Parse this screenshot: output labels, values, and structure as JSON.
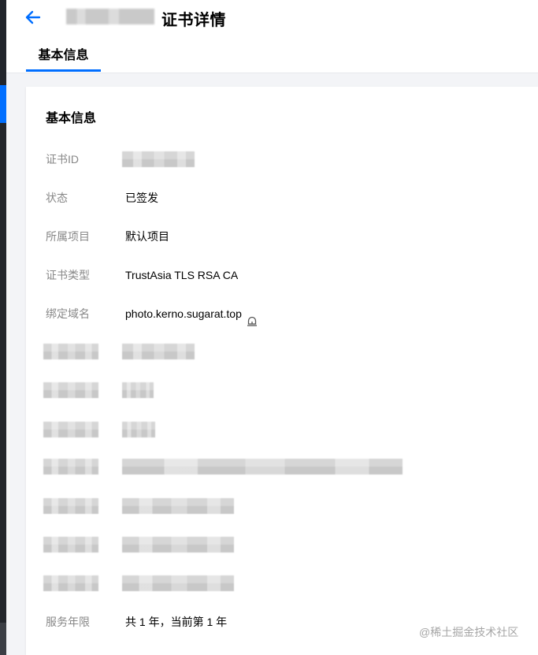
{
  "header": {
    "title": "证书详情",
    "tab_label": "基本信息"
  },
  "card": {
    "title": "基本信息",
    "rows": {
      "cert_id": {
        "label": "证书ID"
      },
      "status": {
        "label": "状态",
        "value": "已签发"
      },
      "project": {
        "label": "所属项目",
        "value": "默认项目"
      },
      "cert_type": {
        "label": "证书类型",
        "value": "TrustAsia TLS RSA CA"
      },
      "domain": {
        "label": "绑定域名",
        "value": "photo.kerno.sugarat.top"
      },
      "service_years": {
        "label": "服务年限",
        "value": "共 1 年，当前第 1 年"
      }
    }
  },
  "watermark": "@稀土掘金技术社区",
  "colors": {
    "accent": "#006eff",
    "label": "#888888",
    "text": "#000000",
    "background": "#f3f4f7"
  },
  "icons": {
    "back": "arrow-left",
    "domain_lock": "lock"
  }
}
